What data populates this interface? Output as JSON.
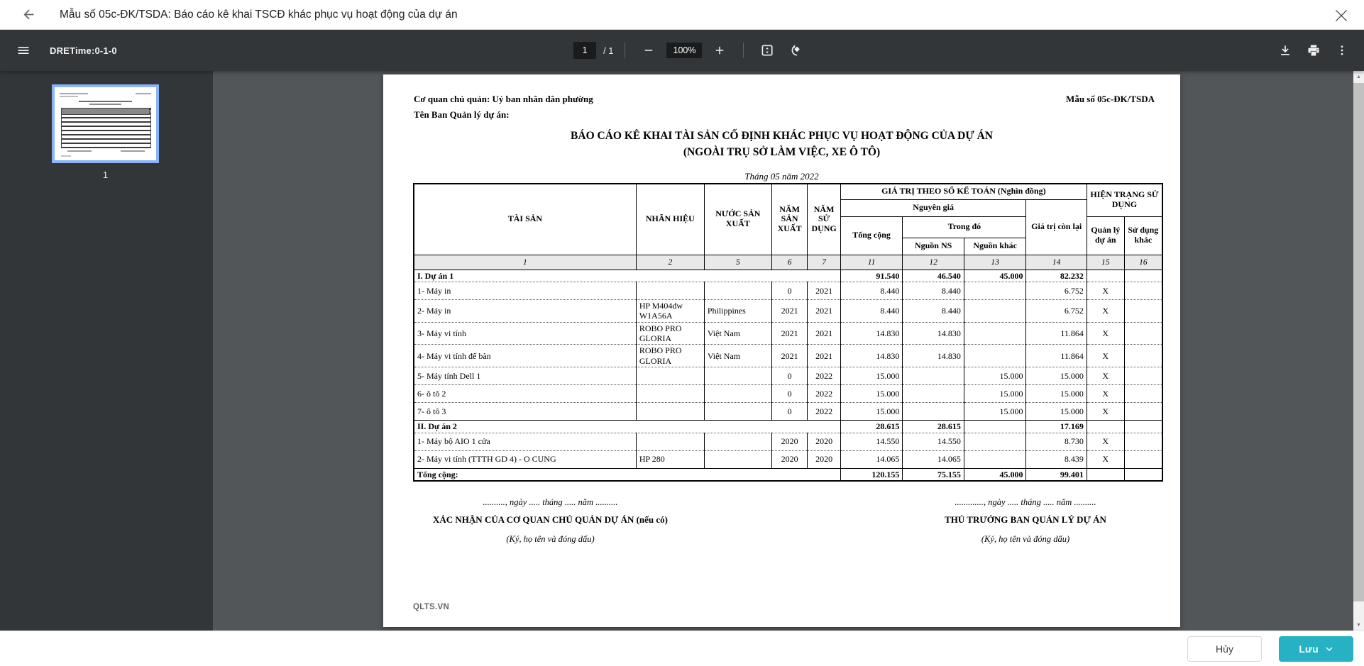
{
  "window": {
    "title": "Mẫu số 05c-ĐK/TSDA: Báo cáo kê khai TSCĐ khác phục vụ hoạt động của dự án"
  },
  "pdf_toolbar": {
    "menu_label": "DRETime:0-1-0",
    "page_current": "1",
    "page_total": "/ 1",
    "zoom_level": "100%"
  },
  "sidebar": {
    "page_number": "1"
  },
  "document": {
    "agency_line": "Cơ quan chủ quản: Uỷ ban nhân dân phường",
    "board_line": "Tên Ban Quản lý dự án:",
    "form_number": "Mẫu số 05c-ĐK/TSDA",
    "title1": "BÁO CÁO KÊ KHAI TÀI SẢN CỐ ĐỊNH KHÁC PHỤC VỤ HOẠT ĐỘNG CỦA DỰ ÁN",
    "title2": "(NGOÀI TRỤ SỞ LÀM VIỆC, XE Ô TÔ)",
    "period": "Tháng 05 năm 2022",
    "watermark": "QLTS.VN",
    "signature": {
      "left_date": "..........,  ngày ..... tháng ..... năm ..........",
      "left_title": "XÁC NHẬN CỦA CƠ QUAN CHỦ QUẢN DỰ ÁN (nếu có)",
      "left_sub": "(Ký, họ tên và đóng dấu)",
      "right_date": ".............,  ngày ..... tháng ..... năm ..........",
      "right_title": "THỦ TRƯỞNG BAN QUẢN LÝ DỰ ÁN",
      "right_sub": "(Ký, họ tên và đóng dấu)"
    }
  },
  "table": {
    "headers": {
      "asset": "TÀI SẢN",
      "brand": "NHÃN HIỆU",
      "country": "NƯỚC SẢN XUẤT",
      "year_made": "NĂM SẢN XUẤT",
      "year_used": "NĂM SỬ DỤNG",
      "value_group": "GIÁ TRỊ THEO SỔ KẾ TOÁN (Nghìn đồng)",
      "original_price": "Nguyên giá",
      "total": "Tổng cộng",
      "of_which": "Trong đó",
      "ns_source": "Nguồn NS",
      "other_source": "Nguồn khác",
      "remaining": "Giá trị còn lại",
      "status_group": "HIỆN TRẠNG SỬ DỤNG",
      "managed": "Quản lý dự án",
      "other_use": "Sử dụng khác"
    },
    "col_numbers": [
      "1",
      "2",
      "5",
      "6",
      "7",
      "11",
      "12",
      "13",
      "14",
      "15",
      "16"
    ],
    "rows": [
      {
        "type": "section",
        "label": "I. Dự án 1",
        "brand": "",
        "country": "",
        "year_made": "",
        "year_used": "",
        "total": "91.540",
        "ns": "46.540",
        "other": "45.000",
        "remaining": "82.232",
        "managed": "",
        "other_use": ""
      },
      {
        "type": "item",
        "label": "1- Máy in",
        "brand": "",
        "country": "",
        "year_made": "0",
        "year_used": "2021",
        "total": "8.440",
        "ns": "8.440",
        "other": "",
        "remaining": "6.752",
        "managed": "X",
        "other_use": ""
      },
      {
        "type": "item",
        "label": "2- Máy in",
        "brand": "HP M404dw W1A56A",
        "country": "Philippines",
        "year_made": "2021",
        "year_used": "2021",
        "total": "8.440",
        "ns": "8.440",
        "other": "",
        "remaining": "6.752",
        "managed": "X",
        "other_use": ""
      },
      {
        "type": "item",
        "label": "3- Máy vi tính",
        "brand": "ROBO PRO GLORIA",
        "country": "Việt Nam",
        "year_made": "2021",
        "year_used": "2021",
        "total": "14.830",
        "ns": "14.830",
        "other": "",
        "remaining": "11.864",
        "managed": "X",
        "other_use": ""
      },
      {
        "type": "item",
        "label": "4- Máy vi tính để bàn",
        "brand": "ROBO PRO GLORIA",
        "country": "Việt Nam",
        "year_made": "2021",
        "year_used": "2021",
        "total": "14.830",
        "ns": "14.830",
        "other": "",
        "remaining": "11.864",
        "managed": "X",
        "other_use": ""
      },
      {
        "type": "item",
        "label": "5- Máy tính Dell 1",
        "brand": "",
        "country": "",
        "year_made": "0",
        "year_used": "2022",
        "total": "15.000",
        "ns": "",
        "other": "15.000",
        "remaining": "15.000",
        "managed": "X",
        "other_use": ""
      },
      {
        "type": "item",
        "label": "6- ô tô 2",
        "brand": "",
        "country": "",
        "year_made": "0",
        "year_used": "2022",
        "total": "15.000",
        "ns": "",
        "other": "15.000",
        "remaining": "15.000",
        "managed": "X",
        "other_use": ""
      },
      {
        "type": "item",
        "label": "7- ô tô 3",
        "brand": "",
        "country": "",
        "year_made": "0",
        "year_used": "2022",
        "total": "15.000",
        "ns": "",
        "other": "15.000",
        "remaining": "15.000",
        "managed": "X",
        "other_use": ""
      },
      {
        "type": "section",
        "label": "II. Dự án 2",
        "brand": "",
        "country": "",
        "year_made": "",
        "year_used": "",
        "total": "28.615",
        "ns": "28.615",
        "other": "",
        "remaining": "17.169",
        "managed": "",
        "other_use": ""
      },
      {
        "type": "item",
        "label": "1- Máy bộ AIO 1 cửa",
        "brand": "",
        "country": "",
        "year_made": "2020",
        "year_used": "2020",
        "total": "14.550",
        "ns": "14.550",
        "other": "",
        "remaining": "8.730",
        "managed": "X",
        "other_use": ""
      },
      {
        "type": "item",
        "label": "2- Máy vi tính (TTTH GD 4) - O CUNG",
        "brand": "HP 280",
        "country": "",
        "year_made": "2020",
        "year_used": "2020",
        "total": "14.065",
        "ns": "14.065",
        "other": "",
        "remaining": "8.439",
        "managed": "X",
        "other_use": ""
      },
      {
        "type": "grand",
        "label": "Tổng cộng:",
        "brand": "",
        "country": "",
        "year_made": "",
        "year_used": "",
        "total": "120.155",
        "ns": "75.155",
        "other": "45.000",
        "remaining": "99.401",
        "managed": "",
        "other_use": ""
      }
    ]
  },
  "footer": {
    "cancel_label": "Hủy",
    "save_label": "Lưu"
  },
  "colors": {
    "accent_teal": "#26b2c4",
    "thumbnail_selection": "#8ab4f8",
    "toolbar_dark": "#323639",
    "viewer_background": "#525659"
  }
}
